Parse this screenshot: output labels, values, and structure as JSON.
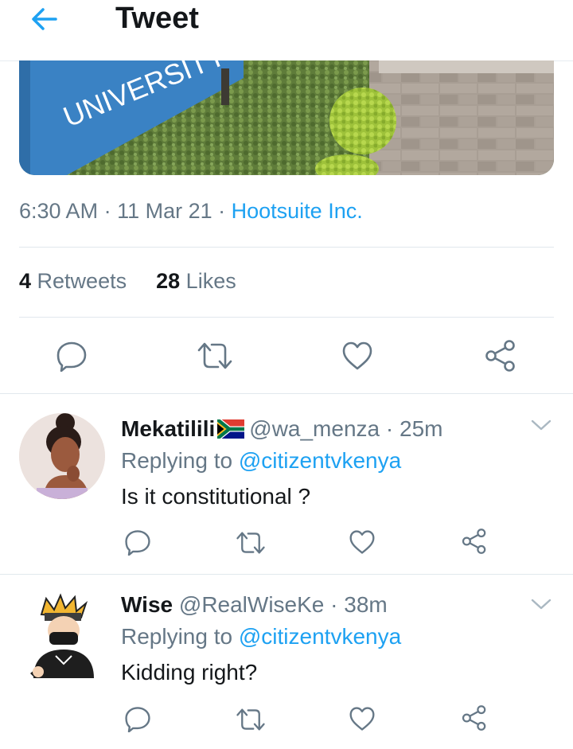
{
  "header": {
    "title": "Tweet",
    "back_icon": "arrow-left-icon"
  },
  "media": {
    "sign_text": "UNIVERSITY OF",
    "description_icon": "photo"
  },
  "meta": {
    "time": "6:30 AM",
    "sep1": " · ",
    "date": "11 Mar 21",
    "sep2": " · ",
    "source": "Hootsuite Inc."
  },
  "stats": {
    "retweets_count": "4",
    "retweets_label": " Retweets",
    "likes_count": "28",
    "likes_label": " Likes"
  },
  "actions": [
    "reply-icon",
    "retweet-icon",
    "like-icon",
    "share-icon"
  ],
  "colors": {
    "accent": "#1da1f2",
    "muted": "#657786",
    "text": "#14171a",
    "divider": "#e1e8ed"
  },
  "replies": [
    {
      "name": "Mekatilili",
      "handle": "@wa_menza",
      "sep": " · ",
      "time": "25m",
      "replying_prefix": "Replying to ",
      "replying_to": "@citizentvkenya",
      "text": "Is it constitutional ?"
    },
    {
      "name": "Wise",
      "handle": "@RealWiseKe",
      "sep": " · ",
      "time": "38m",
      "replying_prefix": "Replying to ",
      "replying_to": "@citizentvkenya",
      "text": "Kidding right?"
    }
  ]
}
